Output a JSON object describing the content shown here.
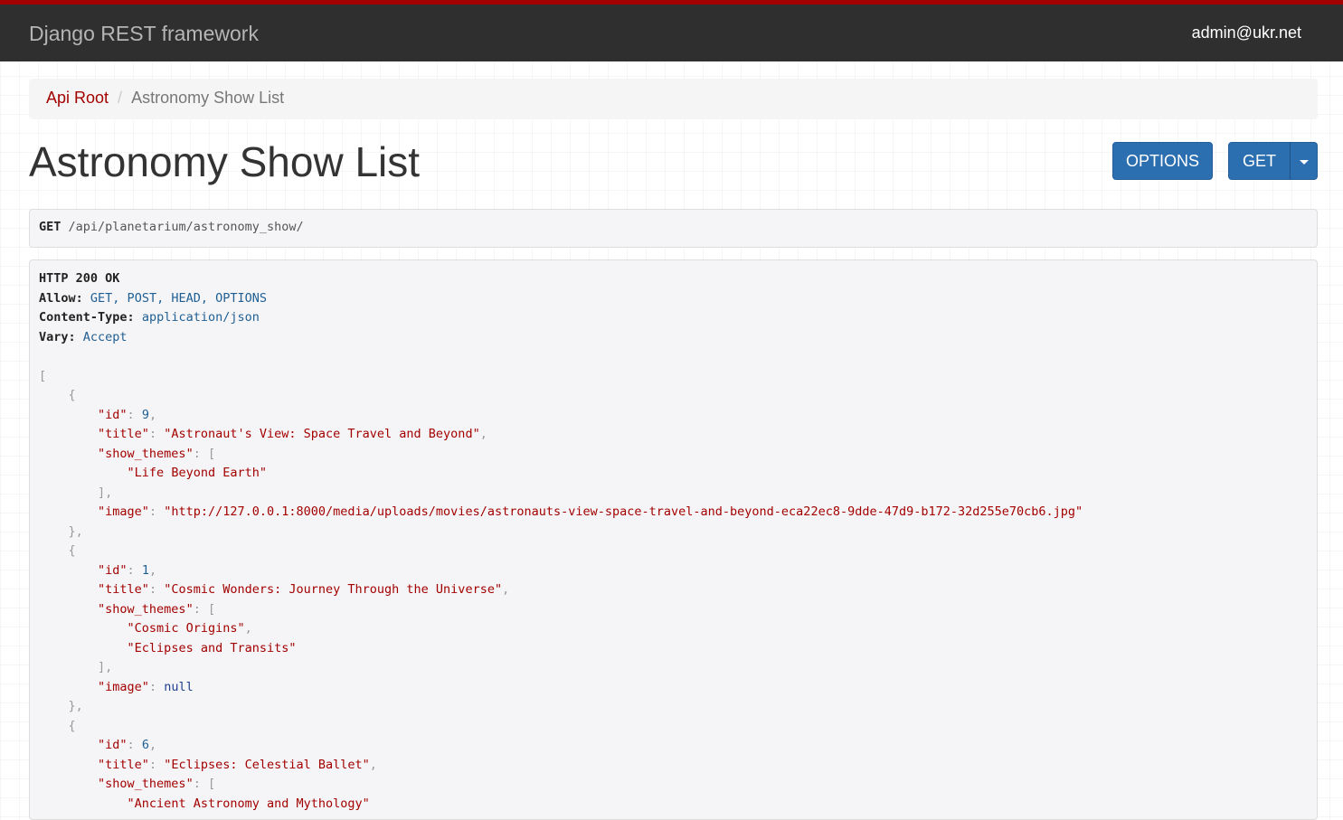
{
  "navbar": {
    "brand": "Django REST framework",
    "user": "admin@ukr.net"
  },
  "breadcrumb": {
    "root": "Api Root",
    "current": "Astronomy Show List"
  },
  "page": {
    "title": "Astronomy Show List"
  },
  "buttons": {
    "options": "OPTIONS",
    "get": "GET"
  },
  "request": {
    "method": "GET",
    "path": "/api/planetarium/astronomy_show/"
  },
  "response": {
    "status": "HTTP 200 OK",
    "headers": [
      {
        "name": "Allow:",
        "value": "GET, POST, HEAD, OPTIONS"
      },
      {
        "name": "Content-Type:",
        "value": "application/json"
      },
      {
        "name": "Vary:",
        "value": "Accept"
      }
    ],
    "items": [
      {
        "id": "9",
        "title": "\"Astronaut's View: Space Travel and Beyond\"",
        "show_themes": [
          "\"Life Beyond Earth\""
        ],
        "image": "\"http://127.0.0.1:8000/media/uploads/movies/astronauts-view-space-travel-and-beyond-eca22ec8-9dde-47d9-b172-32d255e70cb6.jpg\"",
        "image_is_null": false
      },
      {
        "id": "1",
        "title": "\"Cosmic Wonders: Journey Through the Universe\"",
        "show_themes": [
          "\"Cosmic Origins\"",
          "\"Eclipses and Transits\""
        ],
        "image": "null",
        "image_is_null": true
      },
      {
        "id": "6",
        "title": "\"Eclipses: Celestial Ballet\"",
        "show_themes": [
          "\"Ancient Astronomy and Mythology\""
        ],
        "image": "",
        "image_is_null": false
      }
    ]
  },
  "colors": {
    "brand_red": "#a30000",
    "navbar_bg": "#2f2f2f",
    "button_blue": "#2c6fb1"
  }
}
